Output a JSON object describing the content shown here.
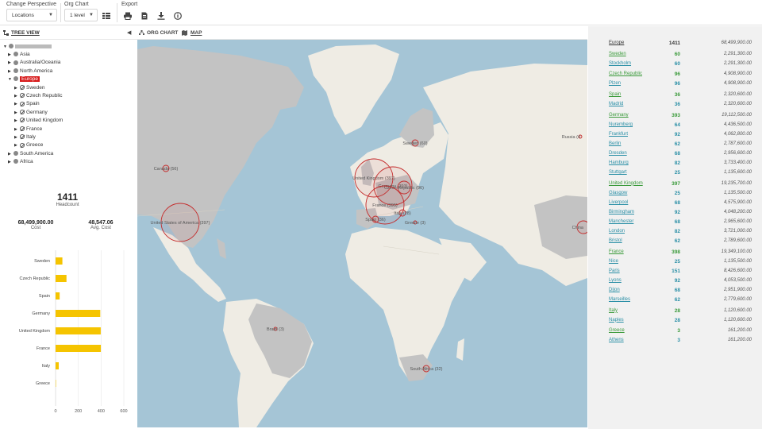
{
  "toolbar": {
    "perspective_label": "Change Perspective",
    "perspective_value": "Locations",
    "orgchart_label": "Org Chart",
    "orgchart_value": "1 level",
    "export_label": "Export",
    "icons": [
      "list-icon",
      "print-icon",
      "document-icon",
      "download-icon",
      "info-icon"
    ]
  },
  "tree": {
    "title": "TREE VIEW",
    "root_label": "",
    "nodes": [
      {
        "label": "Asia",
        "level": 1,
        "expanded": false,
        "selected": false
      },
      {
        "label": "Australia/Oceania",
        "level": 1,
        "expanded": false,
        "selected": false
      },
      {
        "label": "North America",
        "level": 1,
        "expanded": false,
        "selected": false
      },
      {
        "label": "Europe",
        "level": 1,
        "expanded": true,
        "selected": true
      },
      {
        "label": "Sweden",
        "level": 2,
        "expanded": false,
        "selected": false
      },
      {
        "label": "Czech Republic",
        "level": 2,
        "expanded": false,
        "selected": false
      },
      {
        "label": "Spain",
        "level": 2,
        "expanded": false,
        "selected": false
      },
      {
        "label": "Germany",
        "level": 2,
        "expanded": false,
        "selected": false
      },
      {
        "label": "United Kingdom",
        "level": 2,
        "expanded": false,
        "selected": false
      },
      {
        "label": "France",
        "level": 2,
        "expanded": false,
        "selected": false
      },
      {
        "label": "Italy",
        "level": 2,
        "expanded": false,
        "selected": false
      },
      {
        "label": "Greece",
        "level": 2,
        "expanded": false,
        "selected": false
      },
      {
        "label": "South America",
        "level": 1,
        "expanded": false,
        "selected": false
      },
      {
        "label": "Africa",
        "level": 1,
        "expanded": false,
        "selected": false
      }
    ]
  },
  "summary": {
    "headcount": "1411",
    "headcount_label": "Headcount",
    "cost": "68,499,900.00",
    "cost_label": "Cost",
    "avg_cost": "48,547.06",
    "avg_cost_label": "Avg. Cost"
  },
  "chart_data": {
    "type": "bar",
    "orientation": "horizontal",
    "categories": [
      "Sweden",
      "Czech Republic",
      "Spain",
      "Germany",
      "United Kingdom",
      "France",
      "Italy",
      "Greece"
    ],
    "values": [
      60,
      96,
      36,
      393,
      397,
      398,
      28,
      3
    ],
    "xlim": [
      0,
      600
    ],
    "xticks": [
      0,
      200,
      400,
      600
    ],
    "bar_color": "#f5c400",
    "title": "",
    "xlabel": "",
    "ylabel": ""
  },
  "center": {
    "tab_orgchart": "ORG CHART",
    "tab_map": "MAP",
    "map_bubbles": [
      {
        "label": "Sweden (60)",
        "r": 4
      },
      {
        "label": "Canada (56)",
        "r": 4
      },
      {
        "label": "United Kingdom (397)",
        "r": 24
      },
      {
        "label": "Germany (393)",
        "r": 24
      },
      {
        "label": "Czech Republic (96)",
        "r": 8
      },
      {
        "label": "France (395)",
        "r": 24
      },
      {
        "label": "Italy (28)",
        "r": 4
      },
      {
        "label": "Spain (36)",
        "r": 4
      },
      {
        "label": "Greece (3)",
        "r": 2
      },
      {
        "label": "United States of America (397)",
        "r": 24
      },
      {
        "label": "Russia (4",
        "r": 2
      },
      {
        "label": "Brazil (3)",
        "r": 2
      },
      {
        "label": "South Africa (32)",
        "r": 4
      },
      {
        "label": "China",
        "r": 8
      }
    ]
  },
  "right_list": [
    {
      "name": "Europe",
      "hc": "1411",
      "cost": "68,499,900.00",
      "type": "region"
    },
    {
      "name": "Sweden",
      "hc": "60",
      "cost": "2,291,300.00",
      "type": "country"
    },
    {
      "name": "Stockholm",
      "hc": "60",
      "cost": "2,291,300.00",
      "type": "city"
    },
    {
      "name": "Czech Republic",
      "hc": "96",
      "cost": "4,908,900.00",
      "type": "country"
    },
    {
      "name": "Plzen",
      "hc": "96",
      "cost": "4,908,900.00",
      "type": "city"
    },
    {
      "name": "Spain",
      "hc": "36",
      "cost": "2,320,600.00",
      "type": "country"
    },
    {
      "name": "Madrid",
      "hc": "36",
      "cost": "2,320,600.00",
      "type": "city"
    },
    {
      "name": "Germany",
      "hc": "393",
      "cost": "19,112,500.00",
      "type": "country"
    },
    {
      "name": "Nuremberg",
      "hc": "64",
      "cost": "4,436,500.00",
      "type": "city"
    },
    {
      "name": "Frankfurt",
      "hc": "92",
      "cost": "4,062,800.00",
      "type": "city"
    },
    {
      "name": "Berlin",
      "hc": "62",
      "cost": "2,787,600.00",
      "type": "city"
    },
    {
      "name": "Dresden",
      "hc": "68",
      "cost": "2,956,600.00",
      "type": "city"
    },
    {
      "name": "Hamburg",
      "hc": "82",
      "cost": "3,733,400.00",
      "type": "city"
    },
    {
      "name": "Stuttgart",
      "hc": "25",
      "cost": "1,135,600.00",
      "type": "city"
    },
    {
      "name": "United Kingdom",
      "hc": "397",
      "cost": "19,235,700.00",
      "type": "country"
    },
    {
      "name": "Glasgow",
      "hc": "25",
      "cost": "1,135,500.00",
      "type": "city"
    },
    {
      "name": "Liverpool",
      "hc": "68",
      "cost": "4,575,900.00",
      "type": "city"
    },
    {
      "name": "Birmingham",
      "hc": "92",
      "cost": "4,048,200.00",
      "type": "city"
    },
    {
      "name": "Manchester",
      "hc": "68",
      "cost": "2,965,600.00",
      "type": "city"
    },
    {
      "name": "London",
      "hc": "82",
      "cost": "3,721,000.00",
      "type": "city"
    },
    {
      "name": "Bristol",
      "hc": "62",
      "cost": "2,789,600.00",
      "type": "city"
    },
    {
      "name": "France",
      "hc": "398",
      "cost": "19,349,100.00",
      "type": "country"
    },
    {
      "name": "Nice",
      "hc": "25",
      "cost": "1,135,500.00",
      "type": "city"
    },
    {
      "name": "Paris",
      "hc": "151",
      "cost": "8,426,600.00",
      "type": "city"
    },
    {
      "name": "Lyons",
      "hc": "92",
      "cost": "4,053,500.00",
      "type": "city"
    },
    {
      "name": "Dijon",
      "hc": "68",
      "cost": "2,951,900.00",
      "type": "city"
    },
    {
      "name": "Marseilles",
      "hc": "62",
      "cost": "2,779,600.00",
      "type": "city"
    },
    {
      "name": "Italy",
      "hc": "28",
      "cost": "1,120,600.00",
      "type": "country"
    },
    {
      "name": "Naples",
      "hc": "28",
      "cost": "1,120,600.00",
      "type": "city"
    },
    {
      "name": "Greece",
      "hc": "3",
      "cost": "161,200.00",
      "type": "country"
    },
    {
      "name": "Athens",
      "hc": "3",
      "cost": "161,200.00",
      "type": "city"
    }
  ],
  "colors": {
    "accent": "#d71a1a",
    "bar": "#f5c400",
    "region_hc": "#333333",
    "country_name": "#3a9a3a",
    "country_hc": "#3a9a3a",
    "city_name": "#2a8fa6",
    "city_hc": "#2a8fa6",
    "ocean": "#a5c5d6",
    "land": "#efece4",
    "land_grey": "#c3c3c3",
    "bubble": "#c42b2b"
  }
}
